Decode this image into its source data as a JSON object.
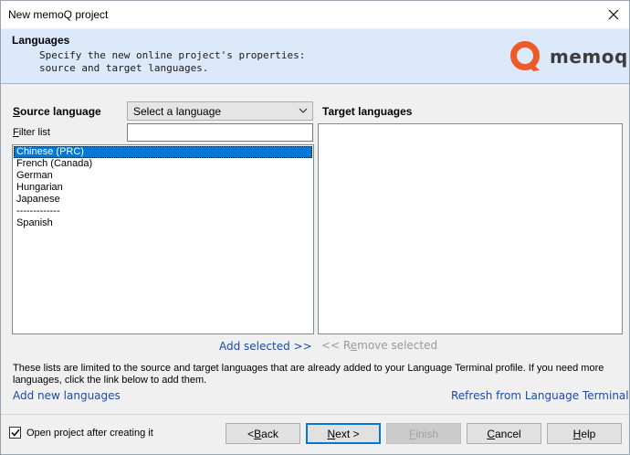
{
  "window": {
    "title": "New memoQ project"
  },
  "header": {
    "title": "Languages",
    "description": "Specify the new online project's properties:\nsource and target languages.",
    "logo_text": "memoq",
    "logo_color": "#f05a28"
  },
  "source": {
    "label_prefix": "S",
    "label_rest": "ource language",
    "select_value": "Select a language",
    "filter_prefix": "F",
    "filter_rest": "ilter list",
    "filter_value": "",
    "items": [
      {
        "label": "Chinese (PRC)",
        "selected": true
      },
      {
        "label": "French (Canada)",
        "selected": false
      },
      {
        "label": "German",
        "selected": false
      },
      {
        "label": "Hungarian",
        "selected": false
      },
      {
        "label": "Japanese",
        "selected": false
      },
      {
        "label": "-------------",
        "selected": false
      },
      {
        "label": "Spanish",
        "selected": false
      }
    ]
  },
  "target": {
    "label": "Target languages",
    "items": []
  },
  "actions": {
    "add_selected": "Add selected >>",
    "remove_prefix": "<< R",
    "remove_underline": "e",
    "remove_rest": "move selected"
  },
  "info": {
    "text": "These lists are limited to the source and target languages that are already added to your Language Terminal profile. If you need more languages, click the link below to add them.",
    "add_new": "Add new languages",
    "refresh": "Refresh from Language Terminal"
  },
  "footer": {
    "open_project_label": "Open project after creating it",
    "open_project_checked": true,
    "back_pre": "< ",
    "back_u": "B",
    "back_rest": "ack",
    "next_u": "N",
    "next_rest": "ext >",
    "finish_u": "F",
    "finish_rest": "inish",
    "cancel_u": "C",
    "cancel_rest": "ancel",
    "help_u": "H",
    "help_rest": "elp"
  },
  "colors": {
    "accent": "#0078d7",
    "header_bg": "#dce9fb",
    "link": "#1a4ba8"
  }
}
